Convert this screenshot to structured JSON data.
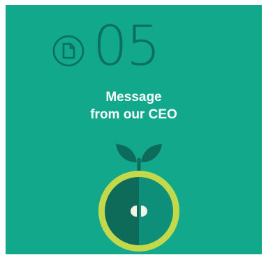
{
  "colors": {
    "background": "#11a88c",
    "number": "#0b6f60",
    "title": "#ffffff",
    "ring": "#c3d94b",
    "apple_dark": "#0e6b5a",
    "apple_light": "#0e8f79",
    "leaf": "#0d6b5b",
    "seed": "#f5f2e8"
  },
  "icon": "document-icon",
  "section": {
    "number": "05",
    "title_line1": "Message",
    "title_line2": "from our CEO"
  }
}
